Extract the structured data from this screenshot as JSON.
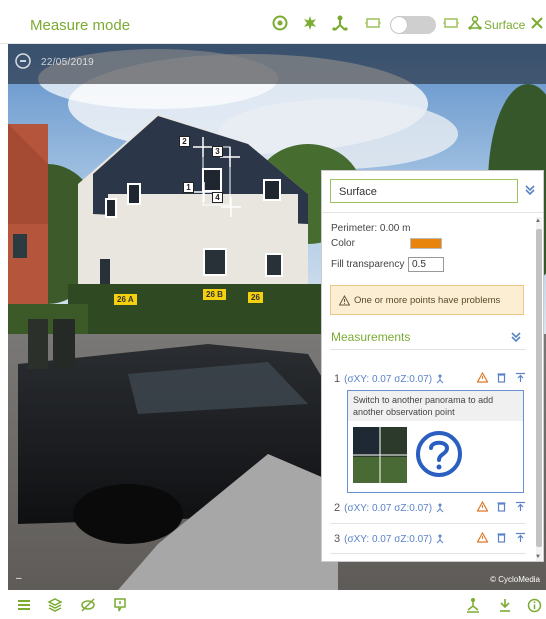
{
  "header": {
    "mode_title": "Measure mode",
    "surface_label": "Surface",
    "icons": [
      "target-icon",
      "star-burst-icon",
      "survey-point-icon",
      "frame-left-icon",
      "view-toggle",
      "frame-right-icon",
      "surface-icon",
      "close-icon"
    ],
    "accent_color": "#7bab32"
  },
  "panorama": {
    "date": "22/05/2019",
    "copyright": "© CycloMedia",
    "point_markers": [
      "1",
      "2",
      "3",
      "4"
    ],
    "address_signs": [
      "26 A",
      "26 B",
      "26"
    ]
  },
  "panel": {
    "geometry_type": "Surface",
    "perimeter_label": "Perimeter: 0.00 m",
    "color_label": "Color",
    "color_value": "#e8830c",
    "fill_transparency_label": "Fill transparency",
    "fill_transparency_value": "0.5",
    "warning_text": "One or more points have problems",
    "measurements_title": "Measurements",
    "observation_hint": "Switch to another panorama to add another observation point",
    "measurements": [
      {
        "index": "1",
        "precision": "(σXY: 0.07 σZ:0.07)"
      },
      {
        "index": "2",
        "precision": "(σXY: 0.07 σZ:0.07)"
      },
      {
        "index": "3",
        "precision": "(σXY: 0.07 σZ:0.07)"
      }
    ]
  },
  "footer": {
    "icons": [
      "menu-icon",
      "layers-icon",
      "hide-icon",
      "comment-icon",
      "survey-tool-icon",
      "download-icon",
      "info-icon"
    ]
  }
}
